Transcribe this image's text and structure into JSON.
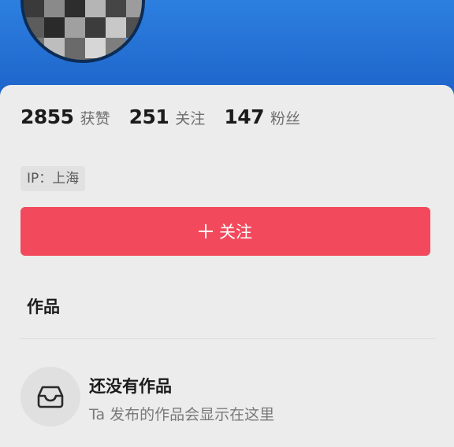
{
  "profile": {
    "avatar_icon": "pixelated-avatar",
    "stats": [
      {
        "value": "2855",
        "label": "获赞"
      },
      {
        "value": "251",
        "label": "关注"
      },
      {
        "value": "147",
        "label": "粉丝"
      }
    ],
    "ip_location": "IP：上海",
    "follow_button": {
      "icon": "plus-icon",
      "label": "关注",
      "color": "#f24a5c"
    }
  },
  "works": {
    "title": "作品",
    "empty_state": {
      "icon": "inbox-tray-icon",
      "title": "还没有作品",
      "description": "Ta 发布的作品会显示在这里"
    }
  },
  "theme": {
    "banner_color": "#1f63c9",
    "card_color": "#ececec"
  }
}
